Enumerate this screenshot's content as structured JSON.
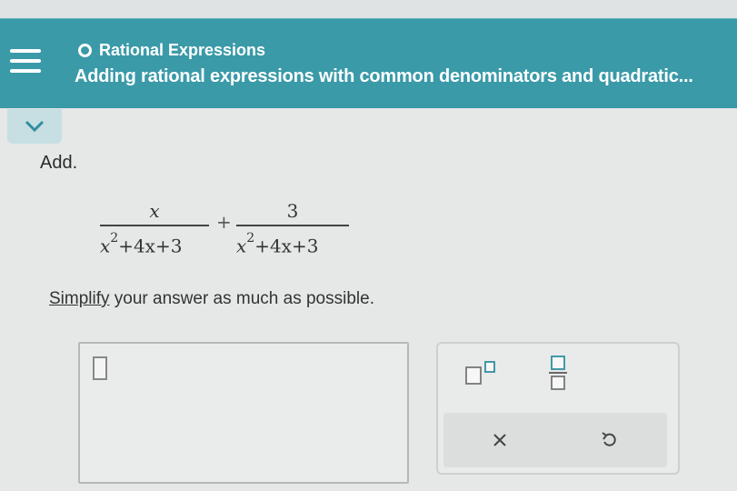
{
  "header": {
    "topic": "Rational Expressions",
    "subtitle": "Adding rational expressions with common denominators and quadratic..."
  },
  "problem": {
    "instruction": "Add.",
    "fraction1": {
      "numerator": "x",
      "den_var": "x",
      "den_exp": "2",
      "den_rest": "+4x+3"
    },
    "operator": "+",
    "fraction2": {
      "numerator": "3",
      "den_var": "x",
      "den_exp": "2",
      "den_rest": "+4x+3"
    },
    "simplify_word": "Simplify",
    "simplify_rest": " your answer as much as possible."
  },
  "toolbar": {
    "tools": [
      "superscript-icon",
      "fraction-icon",
      "clear-icon",
      "undo-icon"
    ]
  },
  "colors": {
    "header": "#3a9aa8",
    "accent": "#2f8fa0"
  }
}
